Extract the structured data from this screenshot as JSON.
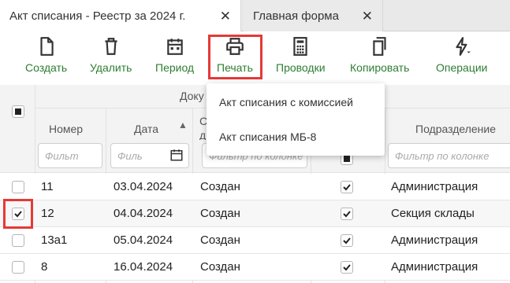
{
  "tabs": [
    {
      "label": "Акт списания - Реестр за 2024 г."
    },
    {
      "label": "Главная форма"
    }
  ],
  "toolbar": {
    "create": "Создать",
    "delete": "Удалить",
    "period": "Период",
    "print": "Печать",
    "postings": "Проводки",
    "copy": "Копировать",
    "operations": "Операции"
  },
  "print_menu": {
    "items": [
      "Акт списания с комиссией",
      "Акт списания МБ-8"
    ]
  },
  "grid": {
    "group_header": "Доку",
    "columns": {
      "number": "Номер",
      "date": "Дата",
      "status_top": "С",
      "status_bottom": "д",
      "department": "Подразделение"
    },
    "filters": {
      "number": "Фильт",
      "date": "Филь",
      "status": "Фильтр по колонке",
      "department": "Фильтр по колонке"
    },
    "rows": [
      {
        "number": "11",
        "date": "03.04.2024",
        "status": "Создан",
        "department": "Администрация",
        "selected": false
      },
      {
        "number": "12",
        "date": "04.04.2024",
        "status": "Создан",
        "department": "Секция склады",
        "selected": true
      },
      {
        "number": "13а1",
        "date": "05.04.2024",
        "status": "Создан",
        "department": "Администрация",
        "selected": false
      },
      {
        "number": "8",
        "date": "16.04.2024",
        "status": "Создан",
        "department": "Администрация",
        "selected": false
      }
    ]
  },
  "colors": {
    "accent": "#2e7d32",
    "highlight": "#e53935"
  }
}
